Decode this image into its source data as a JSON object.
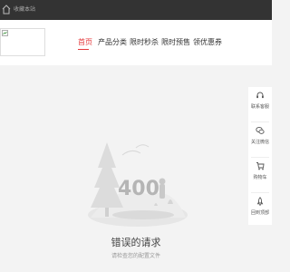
{
  "topbar": {
    "home_text": "收藏本站"
  },
  "header": {
    "logo_alt": "",
    "nav": [
      "首页",
      "产品分类",
      "限时秒杀",
      "限时预售",
      "领优惠券"
    ]
  },
  "sidebar": {
    "items": [
      {
        "label": "联系客服",
        "icon": "headset-icon"
      },
      {
        "label": "关注微信",
        "icon": "wechat-icon"
      },
      {
        "label": "购物车",
        "icon": "cart-icon"
      },
      {
        "label": "回到顶部",
        "icon": "rocket-icon"
      }
    ]
  },
  "error": {
    "code": "400",
    "title": "错误的请求",
    "subtitle": "请检查您的配置文件"
  },
  "colors": {
    "accent": "#e4393c",
    "topbar": "#333333",
    "background": "#f3f3f3"
  }
}
